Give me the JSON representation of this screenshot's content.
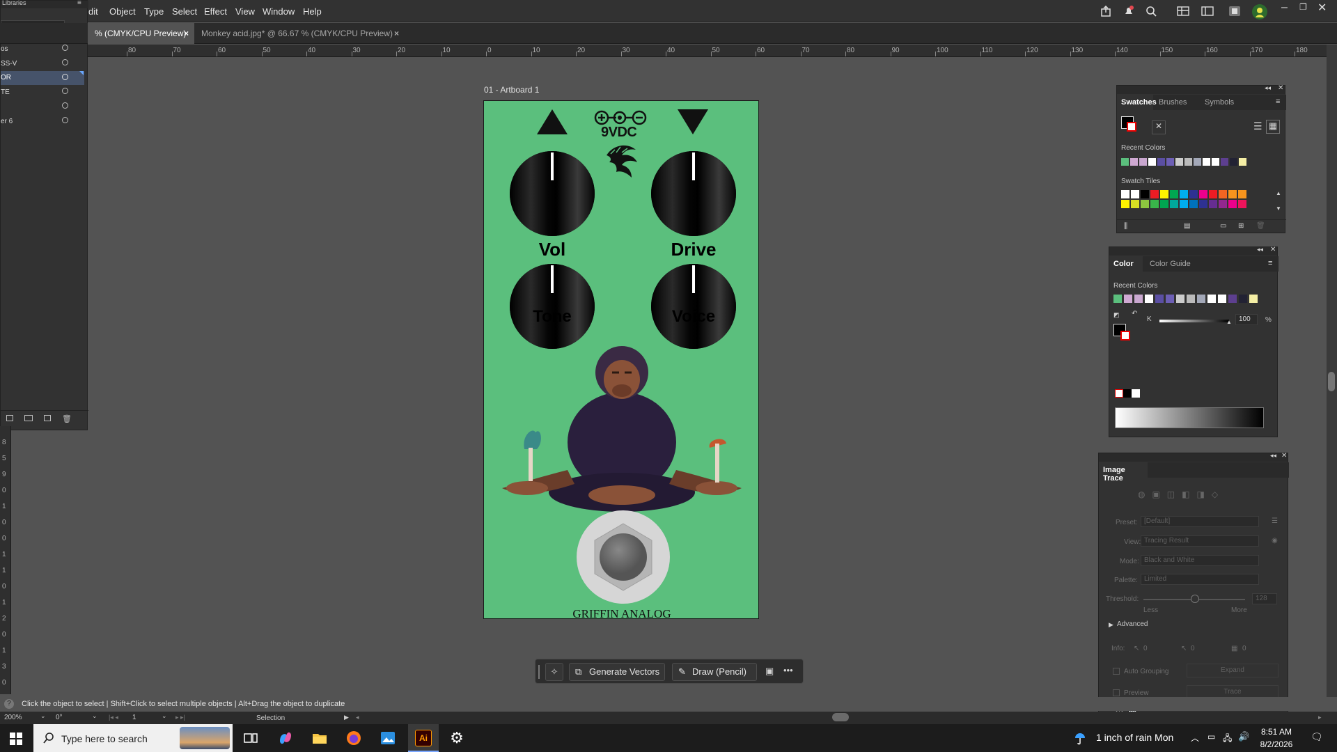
{
  "menubar": {
    "items": [
      "dit",
      "Object",
      "Type",
      "Select",
      "Effect",
      "View",
      "Window",
      "Help"
    ]
  },
  "libraries_panel": {
    "title": "Libraries",
    "layers": [
      {
        "label": "os"
      },
      {
        "label": "SS-V"
      },
      {
        "label": "OR"
      },
      {
        "label": "TE"
      },
      {
        "label": ""
      },
      {
        "label": "er 6"
      }
    ]
  },
  "doc_tabs": [
    {
      "label": "% (CMYK/CPU Preview)",
      "close": "×"
    },
    {
      "label": "Monkey acid.jpg* @ 66.67 % (CMYK/CPU Preview)",
      "close": "×"
    }
  ],
  "ruler_top": [
    "80",
    "70",
    "60",
    "50",
    "40",
    "30",
    "20",
    "10",
    "0",
    "10",
    "20",
    "30",
    "40",
    "50",
    "60",
    "70",
    "80",
    "90",
    "100",
    "110",
    "120",
    "130",
    "140",
    "150",
    "160",
    "170",
    "180"
  ],
  "ruler_left": [
    "8",
    "5",
    "9",
    "0",
    "1",
    "0",
    "0",
    "1",
    "1",
    "0",
    "1",
    "2",
    "0",
    "1",
    "3",
    "0"
  ],
  "artboard": {
    "label": "01 - Artboard 1",
    "power_label": "9VDC",
    "knobs": [
      "Vol",
      "Drive",
      "Tone",
      "Voice"
    ],
    "brand": "GRIFFIN ANALOG",
    "bg_color": "#5bbf7d"
  },
  "swatches_panel": {
    "tabs": [
      "Swatches",
      "Brushes",
      "Symbols"
    ],
    "recent_label": "Recent Colors",
    "tiles_label": "Swatch Tiles",
    "recent_colors": [
      "#5bbf7d",
      "#cfa9d2",
      "#c9a7cf",
      "#ffffff",
      "#5b4fa3",
      "#6d5fb5",
      "#cccccc",
      "#bbbbbb",
      "#a3a8b8",
      "#ffffff",
      "#ffffff",
      "#5d3f8f",
      "#222233",
      "#f5efa5"
    ],
    "tiles": [
      "#ffffff",
      "#ffffff",
      "#000000",
      "#ed1c24",
      "#fff200",
      "#00a651",
      "#00aeef",
      "#2e3192",
      "#ec008c",
      "#ed1c24",
      "#f26522",
      "#f7941d",
      "#f7941d",
      "#fff200",
      "#d7df23",
      "#8dc63f",
      "#39b54a",
      "#00a651",
      "#00a99d",
      "#00aeef",
      "#0072bc",
      "#2e3192",
      "#662d91",
      "#92278f",
      "#ec008c",
      "#ed145b"
    ]
  },
  "color_panel": {
    "tabs": [
      "Color",
      "Color Guide"
    ],
    "recent_label": "Recent Colors",
    "channel": "K",
    "value": "100",
    "unit": "%",
    "recent_colors": [
      "#5bbf7d",
      "#cfa9d2",
      "#c9a7cf",
      "#ffffff",
      "#5b4fa3",
      "#6d5fb5",
      "#cccccc",
      "#bbbbbb",
      "#a3a8b8",
      "#ffffff",
      "#ffffff",
      "#5d3f8f",
      "#222233",
      "#f5efa5"
    ]
  },
  "image_trace": {
    "title": "Image Trace",
    "preset_label": "Preset:",
    "preset_value": "[Default]",
    "view_label": "View:",
    "view_value": "Tracing Result",
    "mode_label": "Mode:",
    "mode_value": "Black and White",
    "palette_label": "Palette:",
    "palette_value": "Limited",
    "threshold_label": "Threshold:",
    "threshold_value": "128",
    "less_label": "Less",
    "more_label": "More",
    "advanced_label": "Advanced",
    "info_label": "Info:",
    "info_values": [
      "0",
      "0",
      "0"
    ],
    "auto_grouping_label": "Auto Grouping",
    "expand_label": "Expand",
    "preview_label": "Preview",
    "trace_label": "Trace"
  },
  "context_bar": {
    "generate_label": "Generate Vectors",
    "draw_label": "Draw (Pencil)",
    "more_label": "•••"
  },
  "status": {
    "hint": "Click the object to select  |  Shift+Click to select multiple objects  |  Alt+Drag the object to duplicate",
    "zoom": "200%",
    "rotation": "0°",
    "artboard_num": "1",
    "tool": "Selection"
  },
  "taskbar": {
    "search_placeholder": "Type here to search",
    "weather": "1 inch of rain  Mon",
    "time": "8:51 AM",
    "date": "8/2/2026"
  }
}
